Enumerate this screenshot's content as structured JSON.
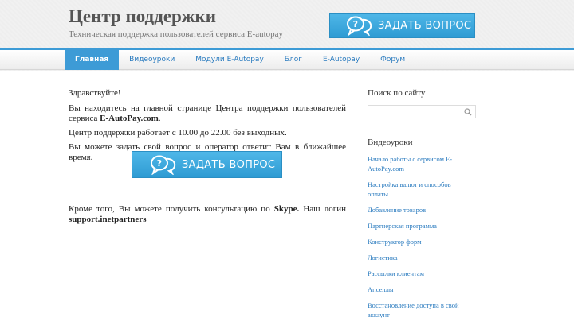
{
  "header": {
    "title": "Центр поддержки",
    "subtitle": "Техническая поддержка пользователей сервиса E-autopay",
    "ask_button_label": "ЗАДАТЬ ВОПРОС"
  },
  "nav": {
    "items": [
      {
        "label": "Главная",
        "active": true
      },
      {
        "label": "Видеоуроки"
      },
      {
        "label": "Модули E-Autopay"
      },
      {
        "label": "Блог"
      },
      {
        "label": "E-Autopay"
      },
      {
        "label": "Форум"
      }
    ]
  },
  "content": {
    "greeting": "Здравствуйте!",
    "intro_text": "Вы находитесь на главной странице Центра поддержки пользователей сервиса ",
    "intro_bold": "E-AutoPay.com",
    "intro_end": ".",
    "hours": "Центр поддержки работает с 10.00 до 22.00 без выходных.",
    "ask_info": "Вы можете задать свой вопрос и оператор ответит Вам в ближайшее время.",
    "ask_button_label": "ЗАДАТЬ ВОПРОС",
    "skype_text": "Кроме того, Вы можете получить консультацию по ",
    "skype_bold": "Skype.",
    "skype_login_text": " Наш логин ",
    "skype_login": "support.inetpartners"
  },
  "sidebar": {
    "search_title": "Поиск по сайту",
    "search_value": "",
    "video_title": "Видеоуроки",
    "videos": [
      "Начало работы с сервисом E-AutoPay.com",
      "Настройка валют и способов оплаты",
      "Добавление товаров",
      "Партнерская программа",
      "Конструктор форм",
      "Логистика",
      "Рассылки клиентам",
      "Апселлы",
      "Восстановление доступа в свой аккаунт"
    ]
  },
  "colors": {
    "accent": "#3d9bd6",
    "button": "#2e9bd3",
    "link": "#2a7bbf"
  }
}
